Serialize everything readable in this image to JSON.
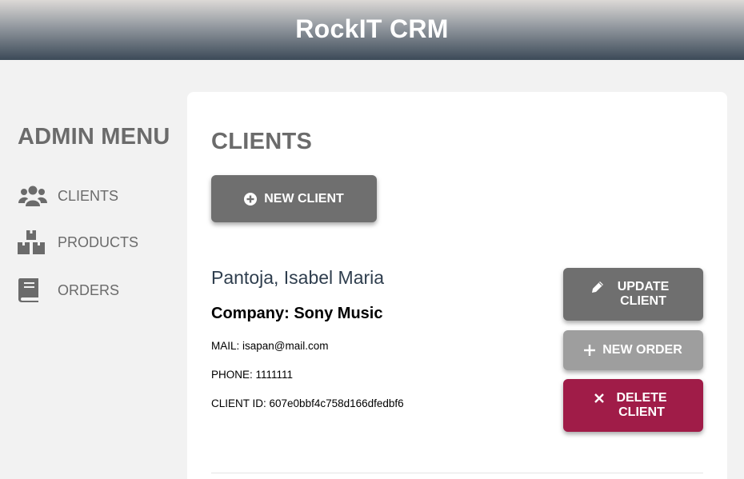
{
  "app": {
    "title": "RockIT CRM"
  },
  "sidebar": {
    "title": "ADMIN MENU",
    "items": [
      {
        "label": "CLIENTS",
        "icon": "users-icon"
      },
      {
        "label": "PRODUCTS",
        "icon": "boxes-icon"
      },
      {
        "label": "ORDERS",
        "icon": "book-icon"
      }
    ]
  },
  "main": {
    "title": "CLIENTS",
    "new_client_label": "NEW CLIENT",
    "client": {
      "name": "Pantoja, Isabel Maria",
      "company": "Company: Sony Music",
      "mail": "MAIL: isapan@mail.com",
      "phone": "PHONE: 1111111",
      "client_id": "CLIENT ID: 607e0bbf4c758d166dfedbf6"
    },
    "actions": {
      "update_label": "UPDATE CLIENT",
      "new_order_label": "NEW ORDER",
      "delete_label": "DELETE CLIENT"
    }
  },
  "colors": {
    "accent_gray": "#6f6f6f",
    "light_gray": "#9e9e9e",
    "danger": "#a01c48",
    "name_color": "#2f3e4e"
  }
}
